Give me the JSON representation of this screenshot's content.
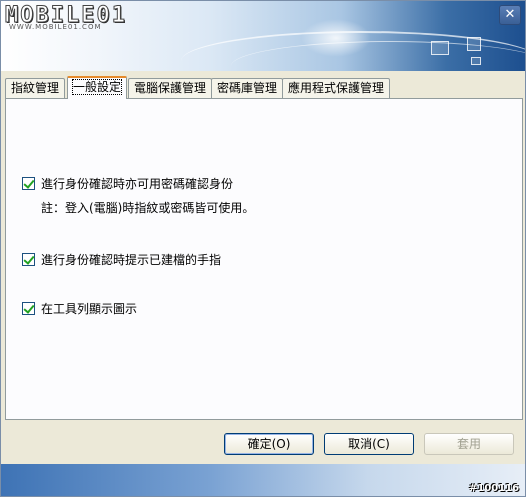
{
  "window": {
    "logo": "MOBILE01",
    "logo_sub": "WWW.MOBILE01.COM",
    "close_glyph": "✕"
  },
  "tabs": [
    {
      "label": "指紋管理",
      "active": false
    },
    {
      "label": "一般設定",
      "active": true
    },
    {
      "label": "電腦保護管理",
      "active": false
    },
    {
      "label": "密碼庫管理",
      "active": false
    },
    {
      "label": "應用程式保護管理",
      "active": false
    }
  ],
  "options": {
    "password_auth": {
      "label": "進行身份確認時亦可用密碼確認身份",
      "checked": true
    },
    "note": "註：登入(電腦)時指紋或密碼皆可使用。",
    "show_registered_finger": {
      "label": "進行身份確認時提示已建檔的手指",
      "checked": true
    },
    "toolbar_icon": {
      "label": "在工具列顯示圖示",
      "checked": true
    }
  },
  "buttons": {
    "ok": "確定(O)",
    "cancel": "取消(C)",
    "apply": "套用"
  },
  "watermark": "#100116",
  "colors": {
    "tab_active_accent": "#e68b2c",
    "check_mark": "#21a121",
    "banner_blue": "#1d4f8f"
  }
}
